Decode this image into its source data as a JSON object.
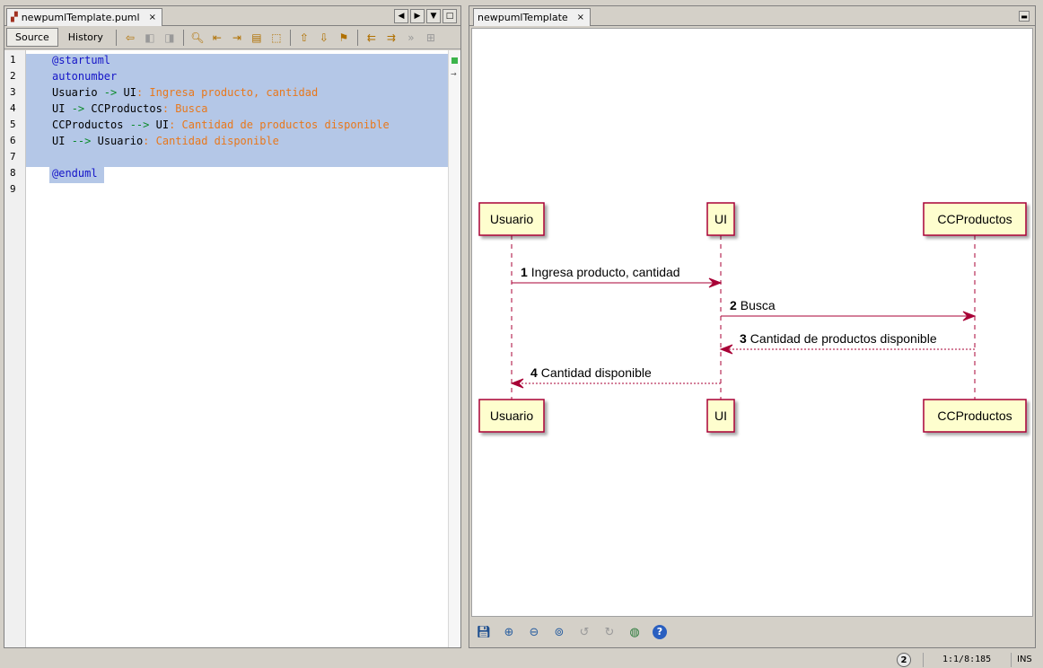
{
  "left_panel": {
    "tab_title": "newpumlTemplate.puml",
    "tab_close": "×",
    "toolbar": {
      "source_label": "Source",
      "history_label": "History"
    },
    "line_numbers": [
      "1",
      "2",
      "3",
      "4",
      "5",
      "6",
      "7",
      "8",
      "9"
    ],
    "code_lines": [
      [
        {
          "t": "@startuml",
          "c": "kw"
        }
      ],
      [
        {
          "t": "autonumber",
          "c": "kw"
        }
      ],
      [
        {
          "t": "Usuario ",
          "c": ""
        },
        {
          "t": "->",
          "c": "op"
        },
        {
          "t": " UI",
          "c": ""
        },
        {
          "t": ": Ingresa producto, cantidad",
          "c": "str"
        }
      ],
      [
        {
          "t": "UI ",
          "c": ""
        },
        {
          "t": "->",
          "c": "op"
        },
        {
          "t": " CCProductos",
          "c": ""
        },
        {
          "t": ": Busca",
          "c": "str"
        }
      ],
      [
        {
          "t": "CCProductos ",
          "c": ""
        },
        {
          "t": "-->",
          "c": "op"
        },
        {
          "t": " UI",
          "c": ""
        },
        {
          "t": ": Cantidad de productos disponible",
          "c": "str"
        }
      ],
      [
        {
          "t": "UI ",
          "c": ""
        },
        {
          "t": "-->",
          "c": "op"
        },
        {
          "t": " Usuario",
          "c": ""
        },
        {
          "t": ": Cantidad disponible",
          "c": "str"
        }
      ],
      [],
      [
        {
          "t": "@enduml",
          "c": "kw"
        }
      ],
      []
    ],
    "colors": {
      "keyword": "#1515c8",
      "arrow": "#0a8a2a",
      "message": "#e8781c",
      "selection": "#b4c7e7"
    }
  },
  "right_panel": {
    "tab_title": "newpumlTemplate",
    "tab_close": "×",
    "diagram": {
      "participants": [
        "Usuario",
        "UI",
        "CCProductos"
      ],
      "messages": [
        {
          "num": "1",
          "text": "Ingresa producto, cantidad",
          "from": "Usuario",
          "to": "UI",
          "style": "solid"
        },
        {
          "num": "2",
          "text": "Busca",
          "from": "UI",
          "to": "CCProductos",
          "style": "solid"
        },
        {
          "num": "3",
          "text": "Cantidad de productos disponible",
          "from": "CCProductos",
          "to": "UI",
          "style": "dashed"
        },
        {
          "num": "4",
          "text": "Cantidad disponible",
          "from": "UI",
          "to": "Usuario",
          "style": "dashed"
        }
      ],
      "colors": {
        "box_fill": "#fefece",
        "box_border": "#a80036",
        "arrow": "#a80036"
      }
    },
    "bottom_icons": [
      "save-icon",
      "zoom-in-icon",
      "zoom-out-icon",
      "zoom-fit-icon",
      "rotate-left-icon",
      "rotate-right-icon",
      "globe-icon",
      "help-icon"
    ]
  },
  "status_bar": {
    "notifications": "2",
    "position": "1:1/8:185",
    "mode": "INS"
  }
}
